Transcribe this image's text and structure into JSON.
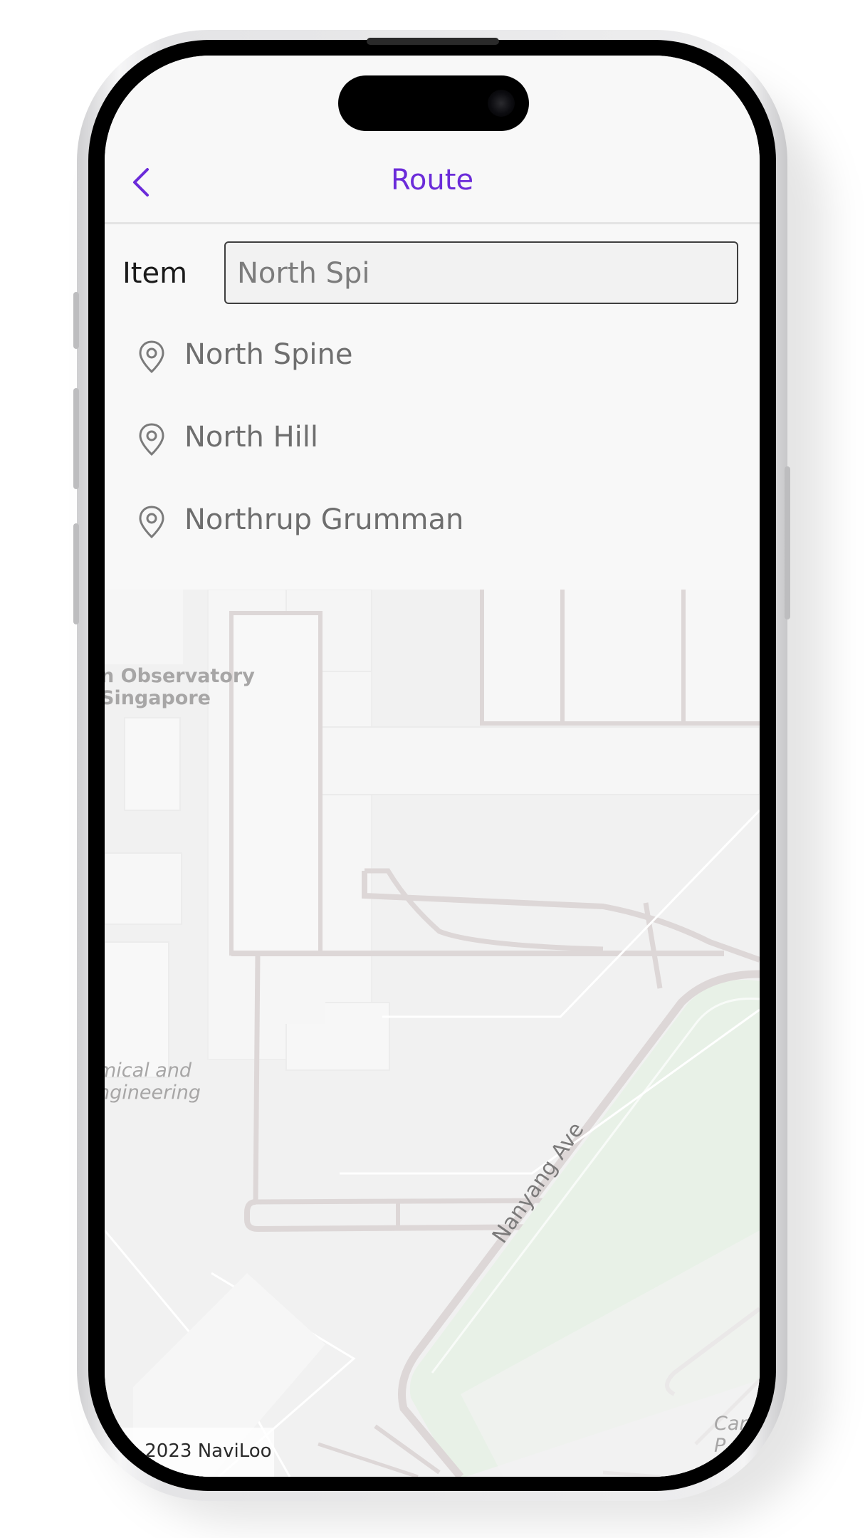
{
  "navbar": {
    "title": "Route"
  },
  "search": {
    "label": "Item",
    "value": "North Spi"
  },
  "suggestions": [
    {
      "label": "North Spine",
      "icon": "location-pin-icon"
    },
    {
      "label": "North Hill",
      "icon": "location-pin-icon"
    },
    {
      "label": "Northrup Grumman",
      "icon": "location-pin-icon"
    }
  ],
  "map": {
    "labels": {
      "observatory_line1": "n Observatory",
      "observatory_line2": "Singapore",
      "chemical_line1": "mical and",
      "chemical_line2": "ngineering",
      "road": "Nanyang Ave",
      "car": "Car P"
    },
    "attribution": "© 2023 NaviLoo"
  },
  "colors": {
    "accent": "#6b2bd9",
    "park": "#e8f1e7",
    "road": "#dcd7d7"
  }
}
